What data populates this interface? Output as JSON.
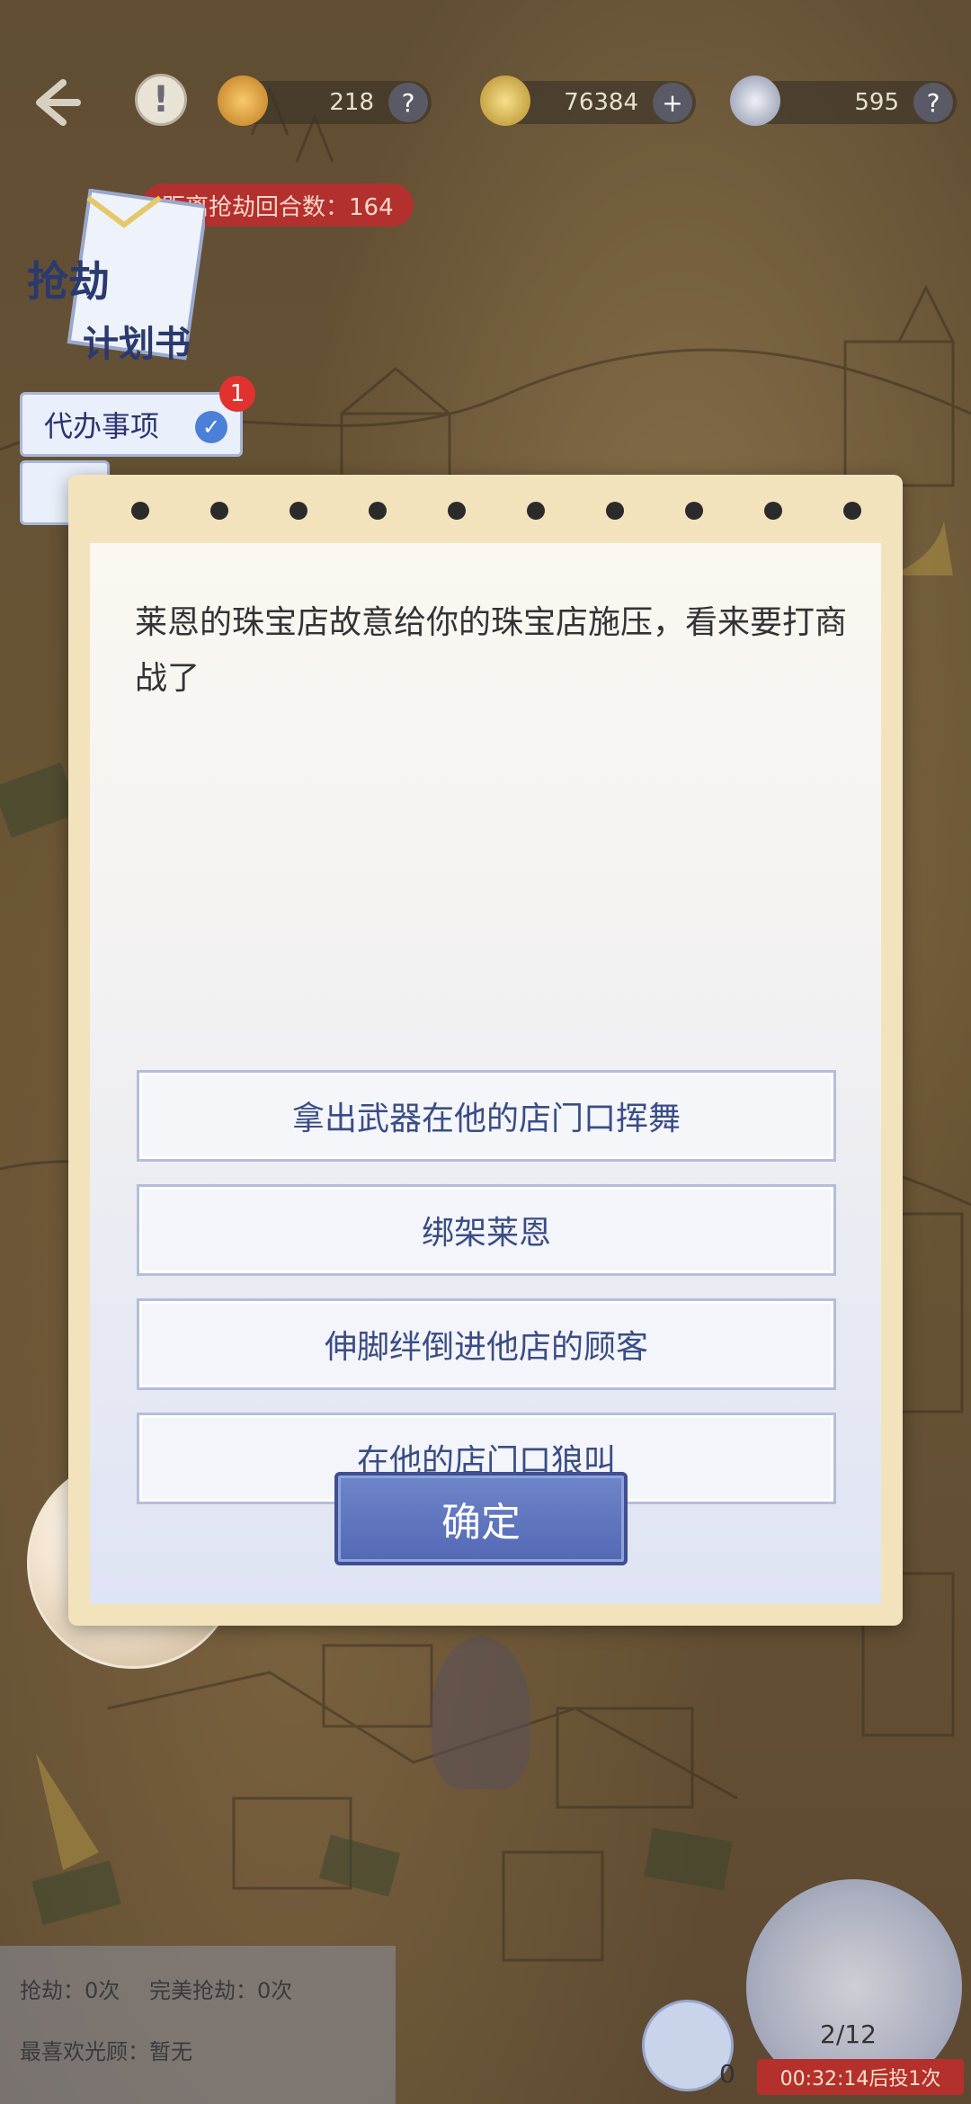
{
  "resources": {
    "res1_value": "218",
    "res2_value": "76384",
    "res3_value": "595",
    "res1_icon": "amber-gem-icon",
    "res2_icon": "gold-coin-icon",
    "res3_icon": "silver-coin-icon"
  },
  "round_counter": "距离抢劫回合数：164",
  "plan_book": {
    "title_line1": "抢劫",
    "title_line2": "计划书"
  },
  "todo": {
    "label": "代办事项",
    "badge": "1"
  },
  "dialog": {
    "prompt": "莱恩的珠宝店故意给你的珠宝店施压，看来要打商战了",
    "options": [
      "拿出武器在他的店门口挥舞",
      "绑架莱恩",
      "伸脚绊倒进他店的顾客",
      "在他的店门口狼叫"
    ],
    "confirm_label": "确定"
  },
  "stats": {
    "robbery": "抢劫：0次",
    "perfect": "完美抢劫：0次",
    "favorite": "最喜欢光顾：暂无"
  },
  "bottom": {
    "feather_count": "0",
    "progress": "2/12",
    "timer": "00:32:14后投1次"
  },
  "colors": {
    "accent": "#5468b4",
    "badge": "#e0322f",
    "banner": "#b2302e"
  }
}
